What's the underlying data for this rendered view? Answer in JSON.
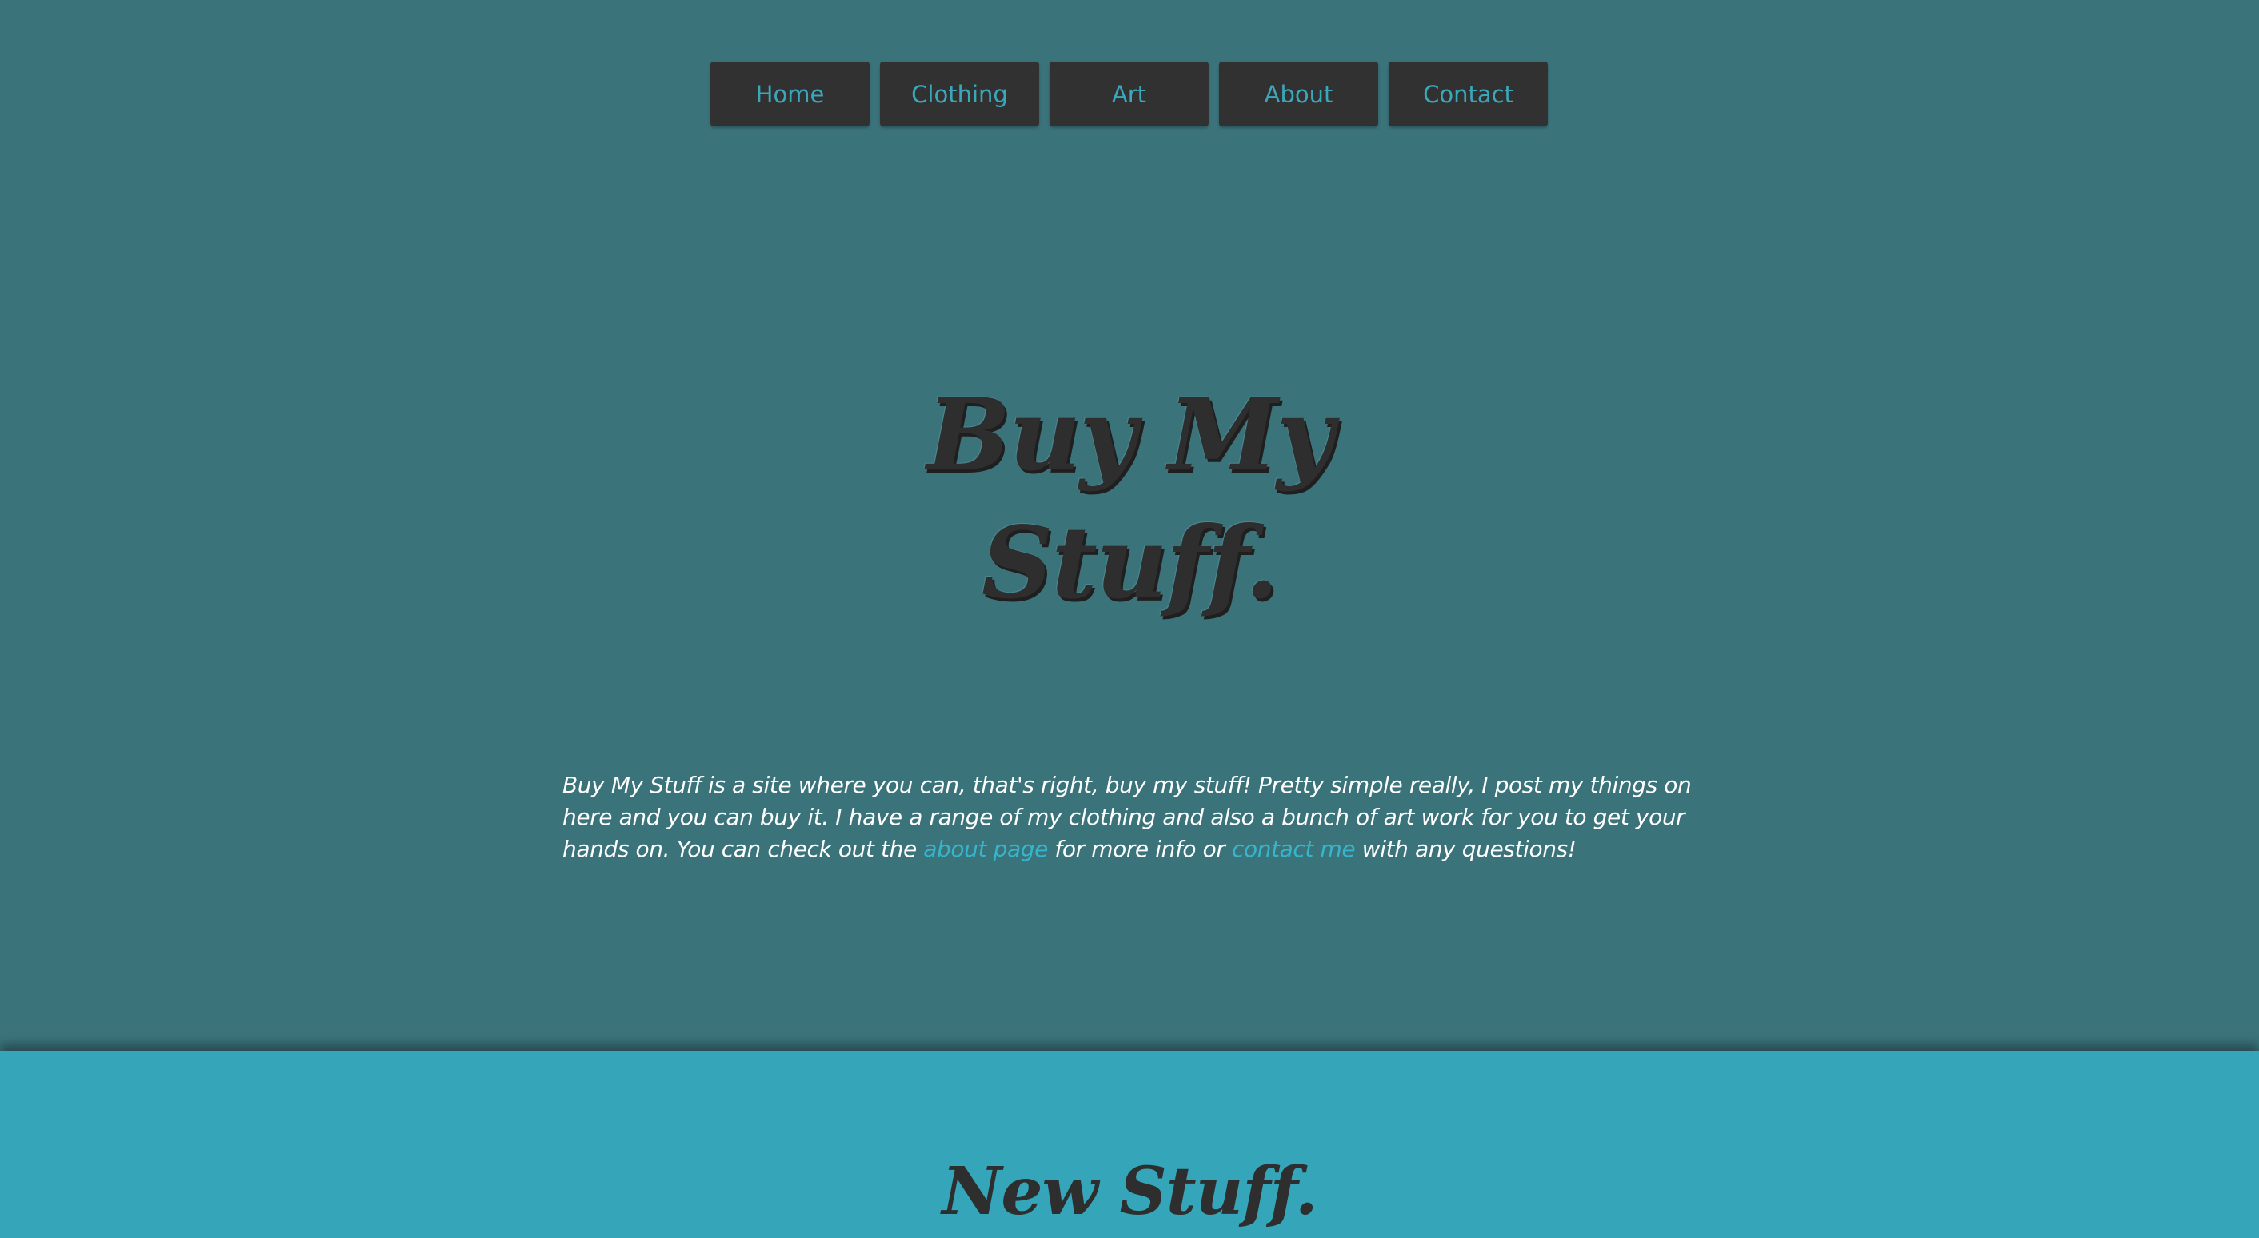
{
  "nav": {
    "items": [
      {
        "label": "Home"
      },
      {
        "label": "Clothing"
      },
      {
        "label": "Art"
      },
      {
        "label": "About"
      },
      {
        "label": "Contact"
      }
    ]
  },
  "hero": {
    "title_line1": "Buy My",
    "title_line2": "Stuff.",
    "intro_text_1": "Buy My Stuff is a site where you can, that's right, buy my stuff! Pretty simple really, I post my things on here and you can buy it. I have a range of my clothing and also a bunch of art work for you to get your hands on. You can check out the ",
    "about_link": "about page",
    "intro_text_2": " for more info or ",
    "contact_link": "contact me",
    "intro_text_3": " with any questions!"
  },
  "new_section": {
    "title": "New Stuff."
  },
  "colors": {
    "hero_bg": "#3b737b",
    "nav_bg": "#313131",
    "nav_text": "#3aa7ba",
    "link": "#36b6cc",
    "section_bg": "#35a6b9",
    "title": "#2e2e2e"
  }
}
